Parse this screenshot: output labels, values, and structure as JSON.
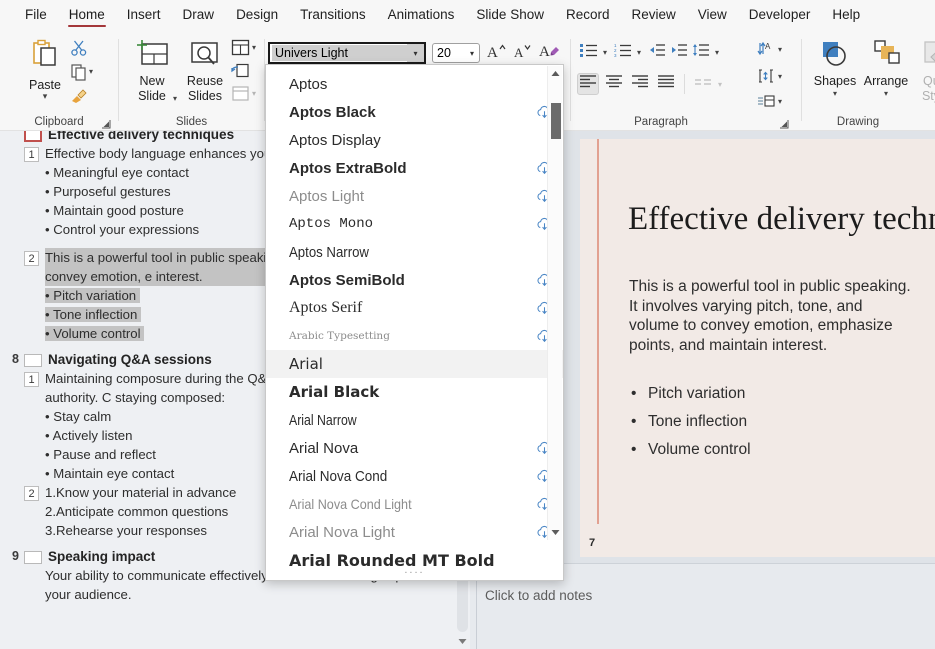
{
  "menu": {
    "items": [
      {
        "label": "File",
        "active": false
      },
      {
        "label": "Home",
        "active": true
      },
      {
        "label": "Insert",
        "active": false
      },
      {
        "label": "Draw",
        "active": false
      },
      {
        "label": "Design",
        "active": false
      },
      {
        "label": "Transitions",
        "active": false
      },
      {
        "label": "Animations",
        "active": false
      },
      {
        "label": "Slide Show",
        "active": false
      },
      {
        "label": "Record",
        "active": false
      },
      {
        "label": "Review",
        "active": false
      },
      {
        "label": "View",
        "active": false
      },
      {
        "label": "Developer",
        "active": false
      },
      {
        "label": "Help",
        "active": false
      }
    ]
  },
  "ribbon": {
    "clipboard": {
      "label": "Clipboard",
      "paste_label": "Paste",
      "paste_icon": "clipboard-icon",
      "cut_icon": "scissors-icon",
      "copy_icon": "copy-icon",
      "format_painter_icon": "paintbrush-icon",
      "dialog_launcher_icon": "dialog-launcher-icon"
    },
    "slides": {
      "label": "Slides",
      "new_slide_label": "New Slide",
      "reuse_slides_label": "Reuse Slides",
      "layout_icon": "layout-icon",
      "reset_icon": "reset-icon",
      "section_icon": "section-icon"
    },
    "font": {
      "name_value": "Univers Light",
      "size_value": "20",
      "increase_size_icon": "increase-font-size-icon",
      "decrease_size_icon": "decrease-font-size-icon",
      "clear_formatting_icon": "clear-formatting-icon"
    },
    "paragraph": {
      "label": "Paragraph",
      "bullets_icon": "bullets-icon",
      "numbering_icon": "numbering-icon",
      "decrease_indent_icon": "decrease-indent-icon",
      "increase_indent_icon": "increase-indent-icon",
      "line_spacing_icon": "line-spacing-icon",
      "align_left_icon": "align-left-icon",
      "align_center_icon": "align-center-icon",
      "align_right_icon": "align-right-icon",
      "justify_icon": "justify-icon",
      "columns_icon": "columns-icon",
      "text_direction_icon": "text-direction-icon",
      "align_text_icon": "align-text-icon",
      "smartart_icon": "convert-to-smartart-icon",
      "dialog_launcher_icon": "dialog-launcher-icon"
    },
    "drawing": {
      "label": "Drawing",
      "shapes_label": "Shapes",
      "arrange_label": "Arrange",
      "quick_styles_label": "Quick Styles"
    }
  },
  "font_dropdown": {
    "scroll_up_icon": "scroll-up-arrow-icon",
    "scroll_down_icon": "scroll-down-arrow-icon",
    "resize_grip_icon": "resize-grip-icon",
    "items": [
      {
        "name": "Aptos",
        "style": "normal",
        "dim": false,
        "cloud": false,
        "hover": false
      },
      {
        "name": "Aptos Black",
        "style": "black",
        "dim": false,
        "cloud": true,
        "hover": false
      },
      {
        "name": "Aptos Display",
        "style": "normal",
        "dim": false,
        "cloud": false,
        "hover": false
      },
      {
        "name": "Aptos ExtraBold",
        "style": "bold",
        "dim": false,
        "cloud": true,
        "hover": false
      },
      {
        "name": "Aptos Light",
        "style": "light",
        "dim": true,
        "cloud": true,
        "hover": false
      },
      {
        "name": "Aptos Mono",
        "style": "mono",
        "dim": false,
        "cloud": true,
        "hover": false
      },
      {
        "name": "Aptos Narrow",
        "style": "narrow",
        "dim": false,
        "cloud": false,
        "hover": false
      },
      {
        "name": "Aptos SemiBold",
        "style": "bold",
        "dim": false,
        "cloud": true,
        "hover": false
      },
      {
        "name": "Aptos Serif",
        "style": "serif",
        "dim": false,
        "cloud": true,
        "hover": false
      },
      {
        "name": "Arabic Typesetting",
        "style": "arabic",
        "dim": true,
        "cloud": true,
        "hover": false
      },
      {
        "name": "Arial",
        "style": "normal",
        "dim": false,
        "cloud": false,
        "hover": true
      },
      {
        "name": "Arial Black",
        "style": "black",
        "dim": false,
        "cloud": false,
        "hover": false
      },
      {
        "name": "Arial Narrow",
        "style": "narrow",
        "dim": false,
        "cloud": false,
        "hover": false
      },
      {
        "name": "Arial Nova",
        "style": "normal",
        "dim": false,
        "cloud": true,
        "hover": false
      },
      {
        "name": "Arial Nova Cond",
        "style": "narrow",
        "dim": false,
        "cloud": true,
        "hover": false
      },
      {
        "name": "Arial Nova Cond Light",
        "style": "light",
        "dim": true,
        "cloud": true,
        "hover": false
      },
      {
        "name": "Arial Nova Light",
        "style": "light",
        "dim": true,
        "cloud": true,
        "hover": false
      },
      {
        "name": "Arial Rounded MT Bold",
        "style": "black",
        "dim": false,
        "cloud": false,
        "hover": false
      }
    ]
  },
  "outline": {
    "slides": [
      {
        "number": "",
        "title": "Effective delivery techniques",
        "icon": "slide-thumb-current-icon",
        "blocks": [
          {
            "num": "1",
            "paragraph": "Effective body language enhances your impactful and memorable.",
            "selected": false,
            "bullets": [
              "Meaningful eye contact",
              "Purposeful gestures",
              "Maintain good posture",
              "Control your expressions"
            ]
          },
          {
            "num": "2",
            "paragraph": "This is a powerful tool in public speaking tone, and volume to convey emotion, e interest.",
            "selected": true,
            "bullets": [
              "Pitch variation",
              "Tone inflection",
              "Volume control"
            ]
          }
        ]
      },
      {
        "number": "8",
        "title": "Navigating Q&A sessions",
        "icon": "slide-thumb-icon",
        "blocks": [
          {
            "num": "1",
            "paragraph": "Maintaining composure during the Q& projecting confidence and authority. C staying composed:",
            "selected": false,
            "bullets": [
              "Stay calm",
              "Actively listen",
              "Pause and reflect",
              "Maintain eye contact"
            ]
          },
          {
            "num": "2",
            "paragraph": "",
            "selected": false,
            "numbered": [
              "1.Know your material in advance",
              "2.Anticipate common questions",
              "3.Rehearse your responses"
            ],
            "bullets": []
          }
        ]
      },
      {
        "number": "9",
        "title": "Speaking impact",
        "icon": "slide-thumb-icon",
        "blocks": [
          {
            "num": "",
            "paragraph": "Your ability to communicate effectively will leave a lasting impact on your audience.",
            "selected": false,
            "bullets": []
          }
        ]
      }
    ],
    "scroll_down_icon": "scroll-down-arrow-icon"
  },
  "slide": {
    "title": "Effective delivery techniques",
    "body": "This is a powerful tool in public speaking. It involves varying pitch, tone, and volume to convey emotion, emphasize points, and maintain interest.",
    "bullets": [
      "Pitch variation",
      "Tone inflection",
      "Volume control"
    ],
    "page_number": "7",
    "background_color": "#f2eae6",
    "accent_color": "#e2a191"
  },
  "notes": {
    "placeholder": "Click to add notes"
  }
}
